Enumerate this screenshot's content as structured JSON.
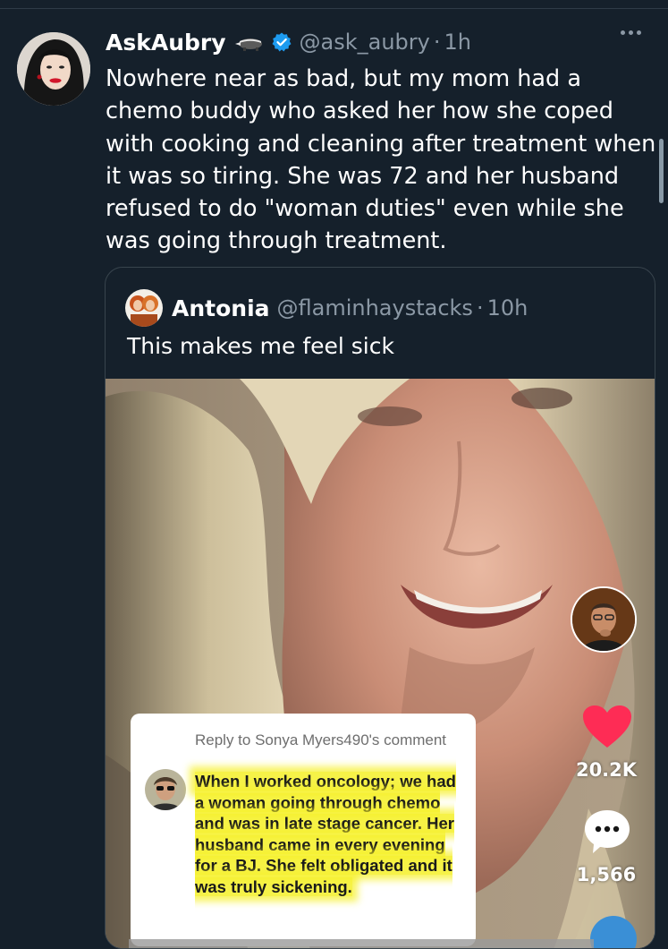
{
  "tweet": {
    "author_name": "AskAubry",
    "handle": "@ask_aubry",
    "time": "1h",
    "separator": "·",
    "text": "Nowhere near as bad, but my mom had a chemo buddy who asked her how she coped with cooking and cleaning after treatment when it was so tiring. She was 72 and her husband refused to do \"woman duties\" even while she was going through treatment."
  },
  "quote": {
    "author_name": "Antonia",
    "handle": "@flaminhaystacks",
    "time": "10h",
    "separator": "·",
    "text": "This makes me feel sick"
  },
  "tiktok": {
    "likes": "20.2K",
    "comments": "1,566",
    "reply_header": "Reply to Sonya Myers490's comment",
    "reply_text": "When I worked oncology; we had a woman going through chemo and was in late stage cancer. Her husband came in every evening for a BJ. She felt obligated and it was truly sickening."
  },
  "colors": {
    "background": "#15202b",
    "secondary_text": "#8b98a5",
    "verified": "#1d9bf0",
    "heart": "#fe2c55",
    "highlight": "#f5f028"
  },
  "icons": [
    "badger-emoji-icon",
    "verified-badge-icon",
    "more-options-icon",
    "heart-icon",
    "comment-bubble-icon",
    "share-icon"
  ]
}
